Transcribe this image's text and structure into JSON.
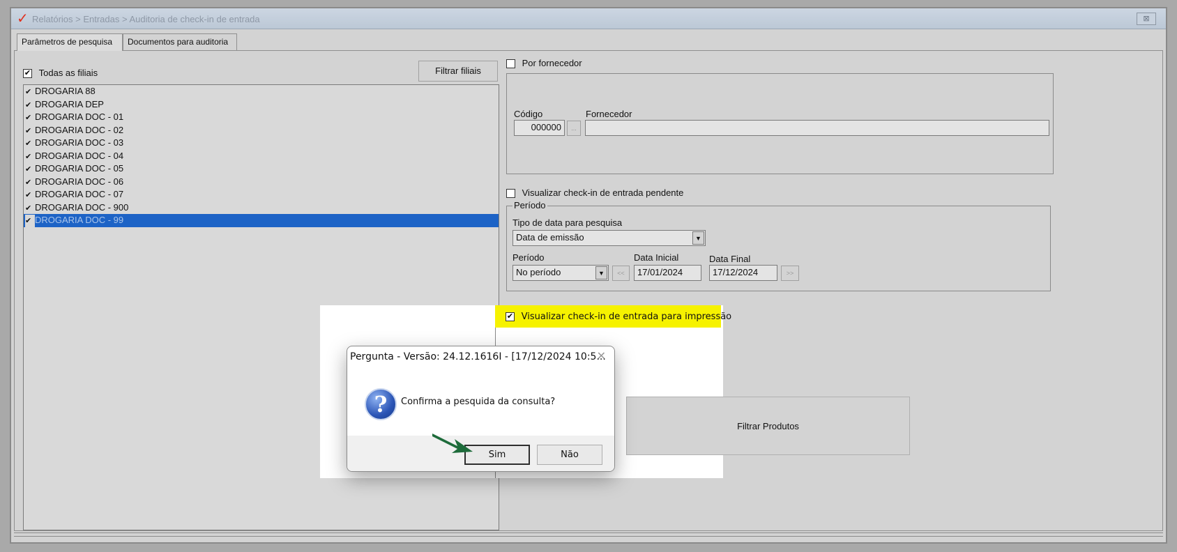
{
  "window": {
    "title": "Relatórios > Entradas > Auditoria de check-in de entrada",
    "close_glyph": "⊠"
  },
  "tabs": [
    {
      "label": "Parâmetros de pesquisa",
      "active": true
    },
    {
      "label": "Documentos para auditoria",
      "active": false
    }
  ],
  "filiais": {
    "todas_label": "Todas as filiais",
    "todas_checked": true,
    "filtrar_button": "Filtrar filiais",
    "items": [
      {
        "label": "DROGARIA 88",
        "checked": true,
        "selected": false
      },
      {
        "label": "DROGARIA DEP",
        "checked": true,
        "selected": false
      },
      {
        "label": "DROGARIA DOC - 01",
        "checked": true,
        "selected": false
      },
      {
        "label": "DROGARIA DOC - 02",
        "checked": true,
        "selected": false
      },
      {
        "label": "DROGARIA DOC - 03",
        "checked": true,
        "selected": false
      },
      {
        "label": "DROGARIA DOC - 04",
        "checked": true,
        "selected": false
      },
      {
        "label": "DROGARIA DOC - 05",
        "checked": true,
        "selected": false
      },
      {
        "label": "DROGARIA DOC - 06",
        "checked": true,
        "selected": false
      },
      {
        "label": "DROGARIA DOC - 07",
        "checked": true,
        "selected": false
      },
      {
        "label": "DROGARIA DOC - 900",
        "checked": true,
        "selected": false
      },
      {
        "label": "DROGARIA DOC - 99",
        "checked": true,
        "selected": true
      }
    ]
  },
  "fornecedor": {
    "checkbox_label": "Por fornecedor",
    "checked": false,
    "codigo_label": "Código",
    "codigo_value": "000000",
    "lookup_button": "...",
    "fornecedor_label": "Fornecedor",
    "fornecedor_value": ""
  },
  "pendente": {
    "checkbox_label": "Visualizar check-in de entrada pendente",
    "checked": false
  },
  "periodo": {
    "group_label": "Período",
    "tipo_data_label": "Tipo de data para pesquisa",
    "tipo_data_value": "Data de emissão",
    "periodo_label": "Período",
    "periodo_value": "No período",
    "prev_button": "<<",
    "next_button": ">>",
    "data_inicial_label": "Data Inicial",
    "data_inicial_value": "17/01/2024",
    "data_final_label": "Data Final",
    "data_final_value": "17/12/2024"
  },
  "impressao": {
    "checkbox_label": "Visualizar check-in de entrada para impressão",
    "checked": true,
    "highlight_color": "#f6f200"
  },
  "filtrar_produtos_button": "Filtrar Produtos",
  "dialog": {
    "title": "Pergunta - Versão: 24.12.1616I - [17/12/2024 10:5...",
    "close_glyph": "✕",
    "icon": "question-icon",
    "icon_glyph": "?",
    "message": "Confirma a pesquida da consulta?",
    "yes_button": "Sim",
    "no_button": "Não"
  },
  "colors": {
    "selection": "#1d63c6",
    "arrow_annotation": "#1d6b3a",
    "brand_logo": "#e0301e"
  }
}
